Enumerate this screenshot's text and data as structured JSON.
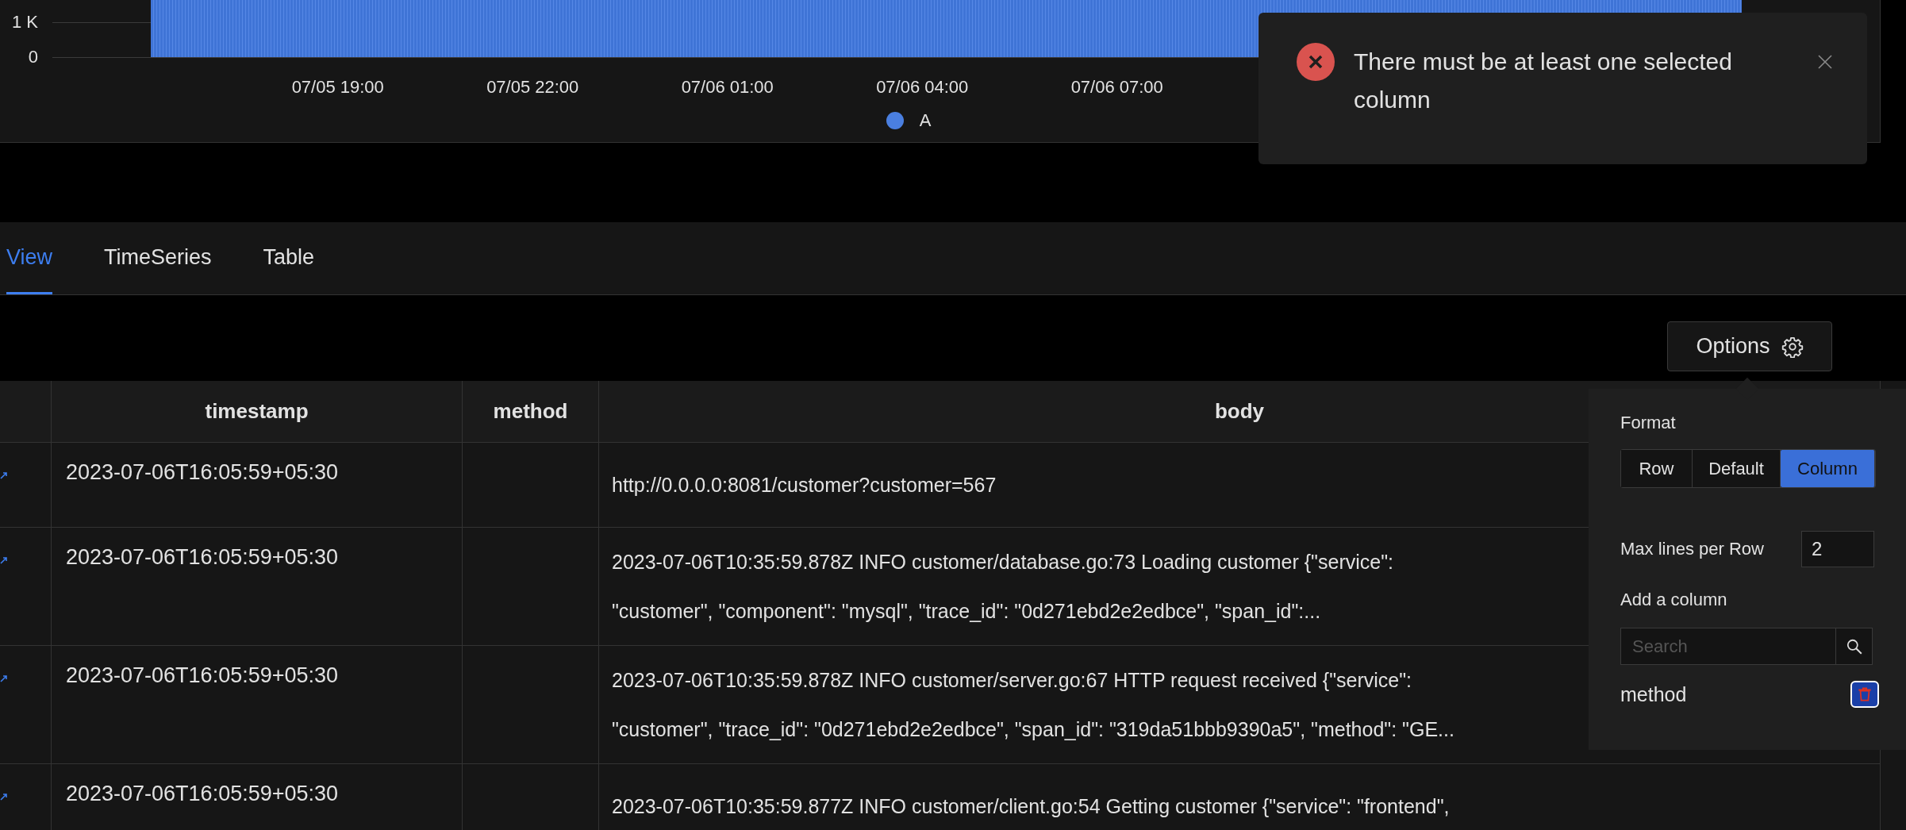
{
  "chart": {
    "y_ticks": [
      "1 K",
      "0"
    ],
    "x_ticks": [
      "07/05 19:00",
      "07/05 22:00",
      "07/06 01:00",
      "07/06 04:00",
      "07/06 07:00"
    ],
    "legend": [
      {
        "label": "A",
        "color": "#4a7fe0"
      }
    ]
  },
  "toast": {
    "kind": "error",
    "message": "There must be at least one selected column"
  },
  "tabs": [
    {
      "label": "View",
      "selected": true
    },
    {
      "label": "TimeSeries",
      "selected": false
    },
    {
      "label": "Table",
      "selected": false
    }
  ],
  "options_button": {
    "label": "Options"
  },
  "table": {
    "columns": [
      "timestamp",
      "method",
      "body"
    ],
    "rows": [
      {
        "timestamp": "2023-07-06T16:05:59+05:30",
        "body": [
          "http://0.0.0.0:8081/customer?customer=567"
        ]
      },
      {
        "timestamp": "2023-07-06T16:05:59+05:30",
        "body": [
          "2023-07-06T10:35:59.878Z INFO customer/database.go:73 Loading customer {\"service\":",
          "\"customer\", \"component\": \"mysql\", \"trace_id\": \"0d271ebd2e2edbce\", \"span_id\":..."
        ]
      },
      {
        "timestamp": "2023-07-06T16:05:59+05:30",
        "body": [
          "2023-07-06T10:35:59.878Z INFO customer/server.go:67 HTTP request received {\"service\":",
          "\"customer\", \"trace_id\": \"0d271ebd2e2edbce\", \"span_id\": \"319da51bbb9390a5\", \"method\": \"GE..."
        ]
      },
      {
        "timestamp": "2023-07-06T16:05:59+05:30",
        "body": [
          "2023-07-06T10:35:59.877Z INFO customer/client.go:54 Getting customer {\"service\": \"frontend\","
        ]
      }
    ]
  },
  "options_panel": {
    "format_label": "Format",
    "formats": [
      {
        "label": "Row",
        "selected": false
      },
      {
        "label": "Default",
        "selected": false
      },
      {
        "label": "Column",
        "selected": true
      }
    ],
    "max_lines_label": "Max lines per Row",
    "max_lines": "2",
    "add_column_label": "Add a column",
    "search": {
      "placeholder": "Search"
    },
    "selected_columns": [
      {
        "name": "method"
      }
    ]
  }
}
